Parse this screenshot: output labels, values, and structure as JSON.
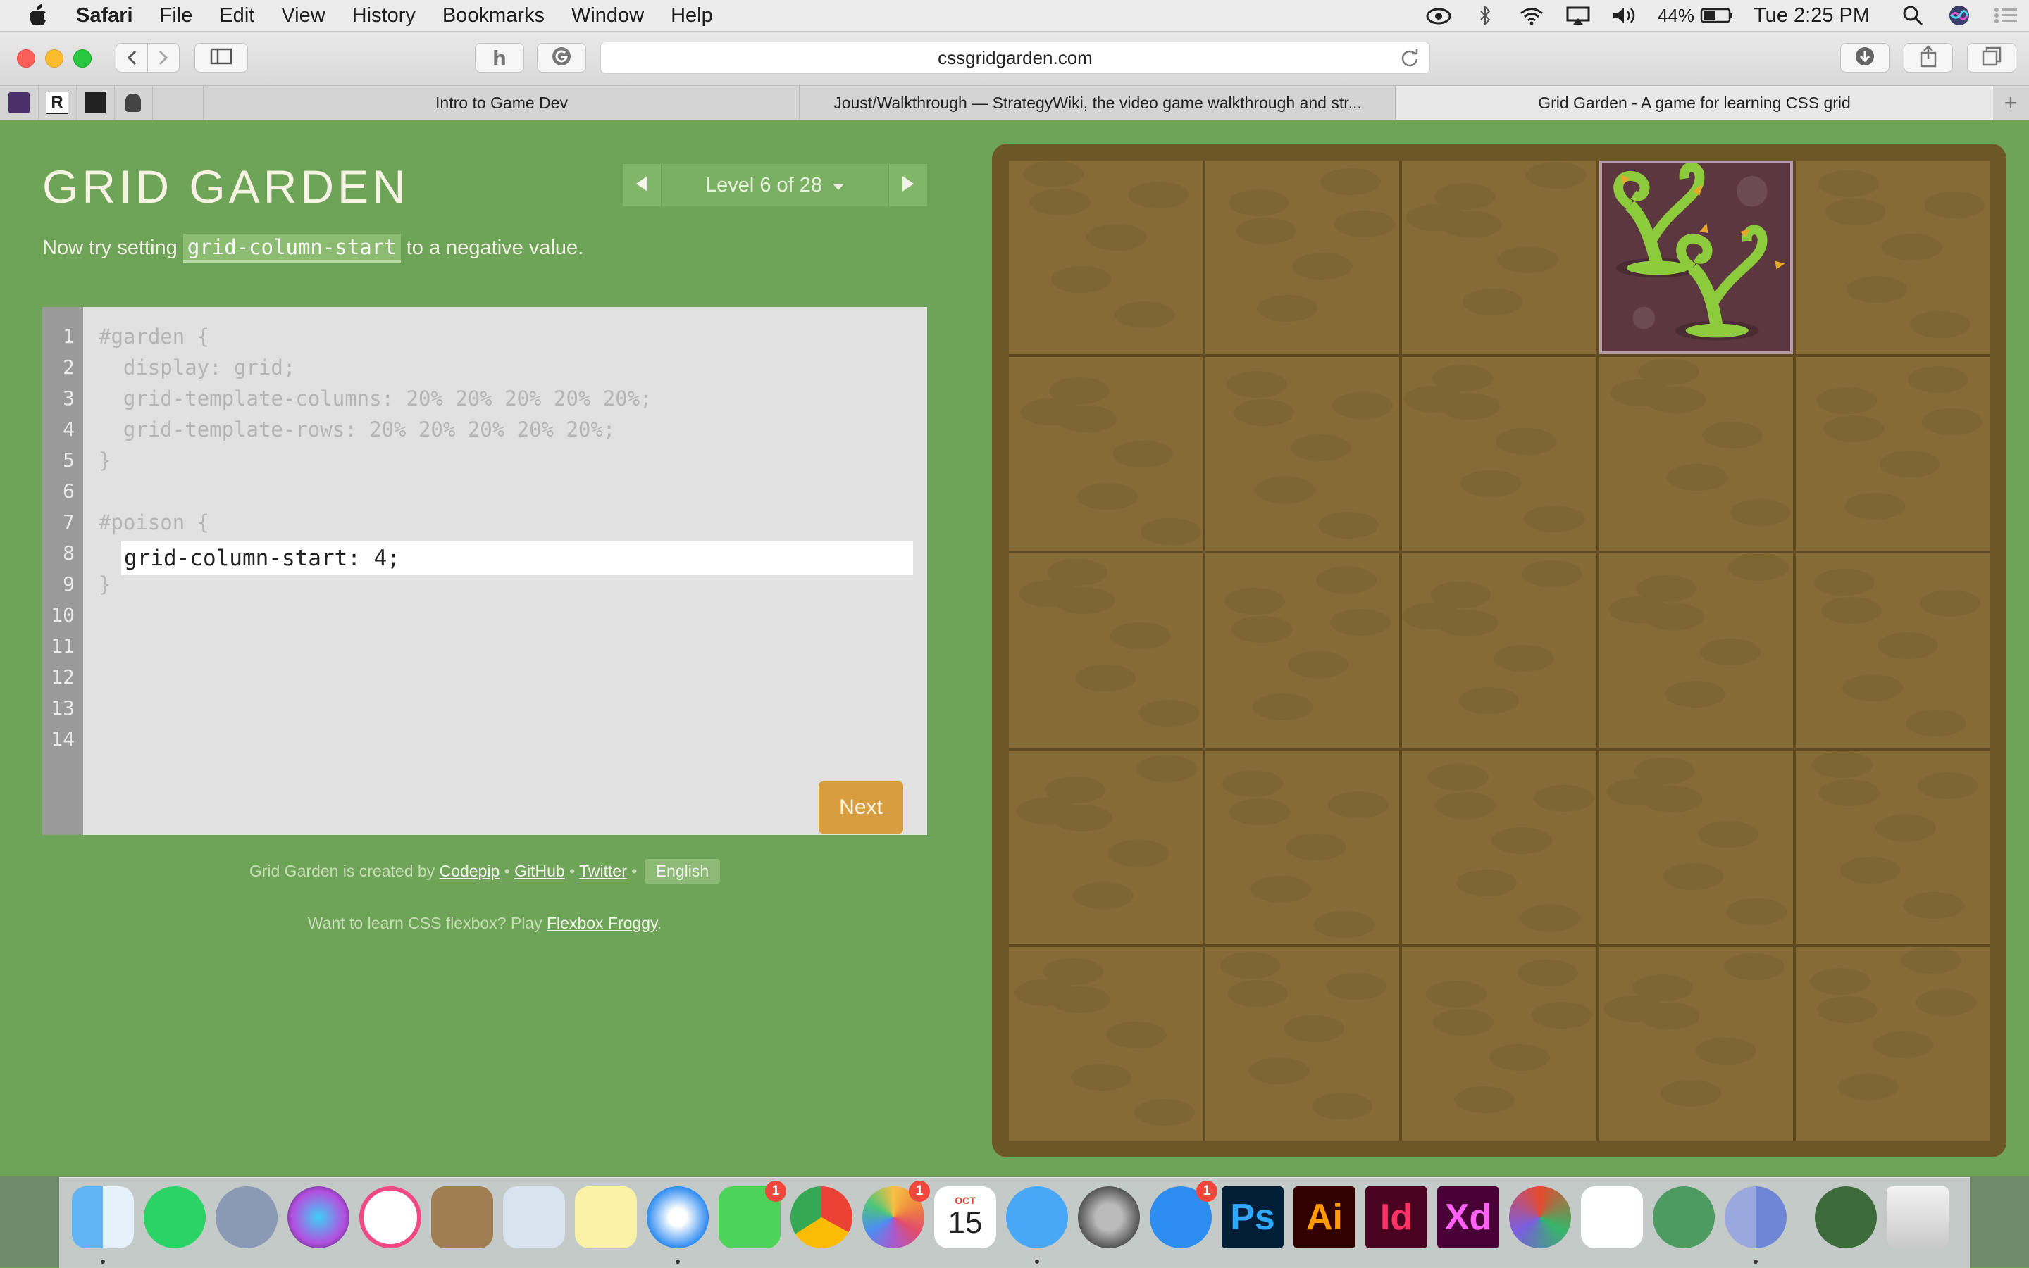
{
  "menubar": {
    "app": "Safari",
    "items": [
      "File",
      "Edit",
      "View",
      "History",
      "Bookmarks",
      "Window",
      "Help"
    ],
    "battery": "44%",
    "clock": "Tue 2:25 PM"
  },
  "browser": {
    "url": "cssgridgarden.com",
    "tabs": [
      {
        "title": "Intro to Game Dev"
      },
      {
        "title": "Joust/Walkthrough — StrategyWiki, the video game walkthrough and str..."
      },
      {
        "title": "Grid Garden - A game for learning CSS grid"
      }
    ]
  },
  "page": {
    "title": "GRID GARDEN",
    "level": "Level 6 of 28",
    "instructions_before": "Now try setting",
    "instructions_code": "grid-column-start",
    "instructions_after": "to a negative value.",
    "line_numbers": [
      "1",
      "2",
      "3",
      "4",
      "5",
      "6",
      "7",
      "8",
      "9",
      "10",
      "11",
      "12",
      "13",
      "14"
    ],
    "code": {
      "l1": "#garden {",
      "l2": "  display: grid;",
      "l3": "  grid-template-columns: 20% 20% 20% 20% 20%;",
      "l4": "  grid-template-rows: 20% 20% 20% 20% 20%;",
      "l5": "}",
      "l7": "#poison {",
      "l9": "}"
    },
    "input_value": "grid-column-start: 4;",
    "next_label": "Next",
    "credits": {
      "prefix": "Grid Garden is created by",
      "codepip": "Codepip",
      "sep1": "•",
      "github": "GitHub",
      "sep2": "•",
      "twitter": "Twitter",
      "sep3": "•",
      "language": "English"
    },
    "promo": {
      "prefix": "Want to learn CSS flexbox? Play",
      "link": "Flexbox Froggy",
      "suffix": "."
    }
  },
  "garden": {
    "columns": 5,
    "rows": 5,
    "poison_column": 4,
    "poison_row": 1
  },
  "dock": {
    "apps": [
      {
        "name": "Finder",
        "icon": "finder-icon",
        "running": true
      },
      {
        "name": "WhatsApp",
        "icon": "whatsapp-icon"
      },
      {
        "name": "Launchpad",
        "icon": "launchpad-icon"
      },
      {
        "name": "Siri",
        "icon": "siri-icon"
      },
      {
        "name": "iTunes",
        "icon": "itunes-icon"
      },
      {
        "name": "Contacts",
        "icon": "contacts-icon"
      },
      {
        "name": "Preview",
        "icon": "preview-icon"
      },
      {
        "name": "Notes",
        "icon": "notes-icon"
      },
      {
        "name": "Safari",
        "icon": "safari-icon",
        "running": true
      },
      {
        "name": "FaceTime",
        "icon": "facetime-icon",
        "badge": "1"
      },
      {
        "name": "Chrome",
        "icon": "chrome-icon"
      },
      {
        "name": "Photos",
        "icon": "photos-icon",
        "badge": "1"
      },
      {
        "name": "Calendar",
        "icon": "calendar-icon",
        "month": "OCT",
        "day": "15"
      },
      {
        "name": "Messages",
        "icon": "messages-icon",
        "running": true
      },
      {
        "name": "System Preferences",
        "icon": "system-preferences-icon"
      },
      {
        "name": "App Store",
        "icon": "app-store-icon",
        "badge": "1"
      },
      {
        "name": "Photoshop",
        "icon": "photoshop-icon",
        "label": "Ps"
      },
      {
        "name": "Illustrator",
        "icon": "illustrator-icon",
        "label": "Ai"
      },
      {
        "name": "InDesign",
        "icon": "indesign-icon",
        "label": "Id"
      },
      {
        "name": "Adobe XD",
        "icon": "xd-icon",
        "label": "Xd"
      },
      {
        "name": "Rider",
        "icon": "rider-icon"
      },
      {
        "name": "GameMaker",
        "icon": "gamemaker-icon"
      },
      {
        "name": "Atom",
        "icon": "atom-icon"
      },
      {
        "name": "Chrome Canary",
        "icon": "chrome-canary-icon",
        "running": true
      },
      {
        "name": "Downloads",
        "icon": "downloads-stack-icon"
      },
      {
        "name": "Trash",
        "icon": "trash-icon"
      }
    ]
  },
  "colors": {
    "page_bg": "#6ea457",
    "garden_soil": "#876b37",
    "poison_bg": "#5d3740",
    "next_button": "#d79d3e"
  }
}
